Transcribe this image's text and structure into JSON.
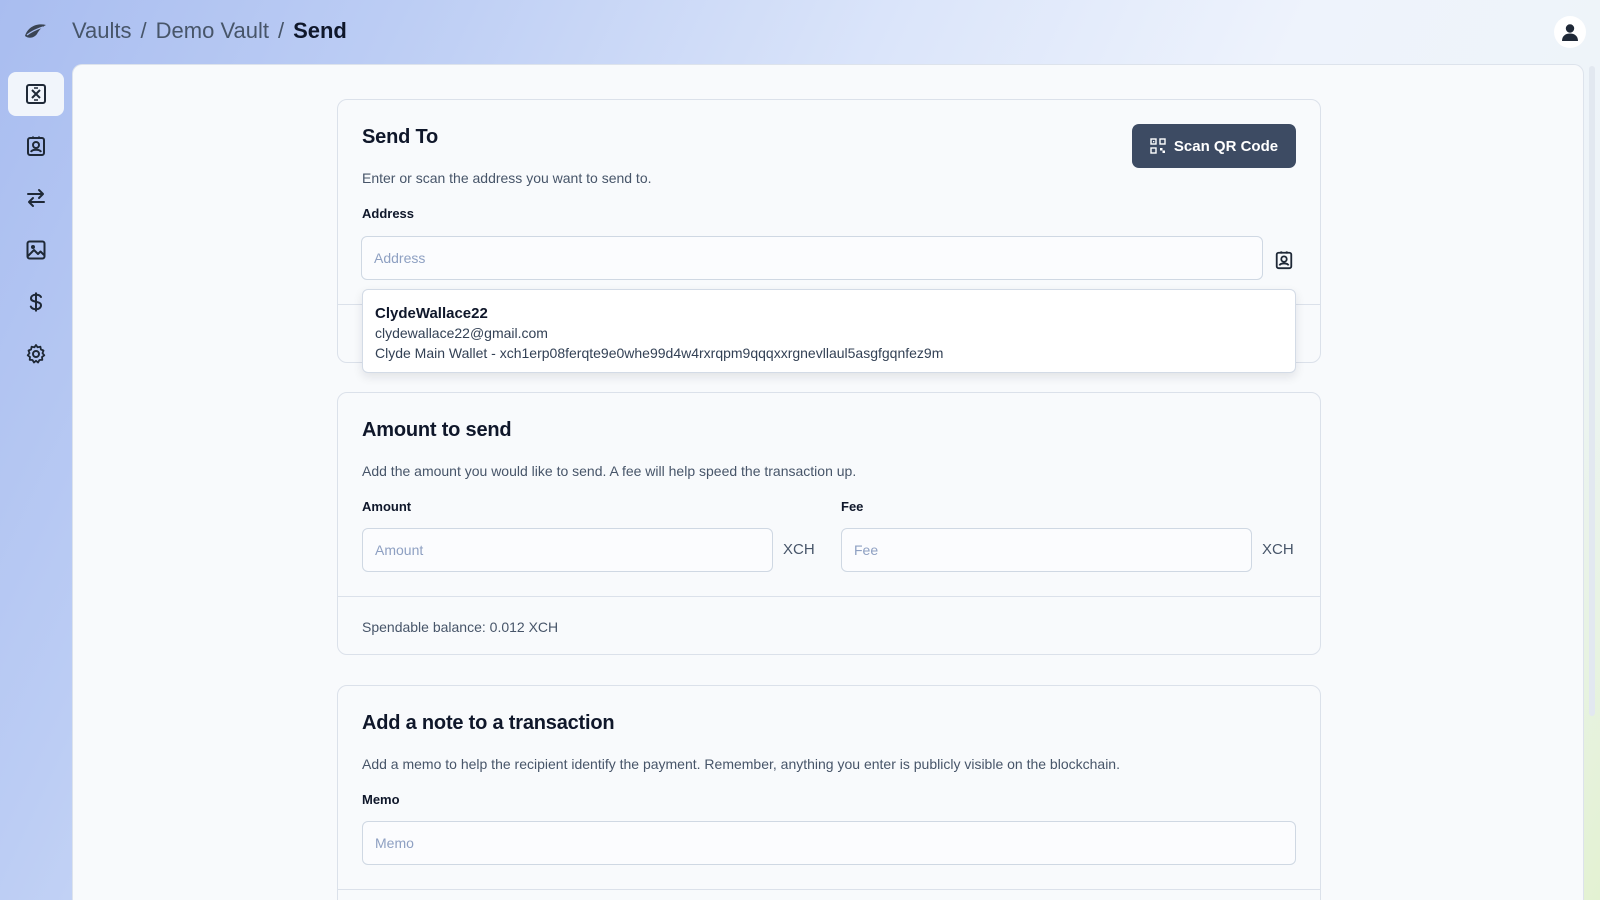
{
  "breadcrumb": {
    "items": [
      "Vaults",
      "Demo Vault"
    ],
    "separator": "/",
    "current": "Send"
  },
  "sidebar": {
    "items": [
      {
        "icon": "chia-icon",
        "active": true
      },
      {
        "icon": "contacts-icon",
        "active": false
      },
      {
        "icon": "transfer-arrows-icon",
        "active": false
      },
      {
        "icon": "image-icon",
        "active": false
      },
      {
        "icon": "dollar-icon",
        "active": false
      },
      {
        "icon": "gear-icon",
        "active": false
      }
    ]
  },
  "send_to": {
    "title": "Send To",
    "description": "Enter or scan the address you want to send to.",
    "scan_button": "Scan QR Code",
    "address_label": "Address",
    "address_placeholder": "Address",
    "address_value": "",
    "suggestion": {
      "name": "ClydeWallace22",
      "email": "clydewallace22@gmail.com",
      "wallet": "Clyde Main Wallet - xch1erp08ferqte9e0whe99d4w4rxrqpm9qqqxxrgnevllaul5asgfgqnfez9m"
    }
  },
  "amount": {
    "title": "Amount to send",
    "description": "Add the amount you would like to send. A fee will help speed the transaction up.",
    "amount_label": "Amount",
    "amount_placeholder": "Amount",
    "amount_unit": "XCH",
    "fee_label": "Fee",
    "fee_placeholder": "Fee",
    "fee_unit": "XCH",
    "balance_text": "Spendable balance: 0.012 XCH"
  },
  "memo": {
    "title": "Add a note to a transaction",
    "description": "Add a memo to help the recipient identify the payment. Remember, anything you enter is publicly visible on the blockchain.",
    "memo_label": "Memo",
    "memo_placeholder": "Memo"
  },
  "colors": {
    "primary_button": "#3d4b63",
    "panel_bg": "#f8fafc",
    "placeholder": "#8ea0c2",
    "border": "#cfd8e3"
  }
}
